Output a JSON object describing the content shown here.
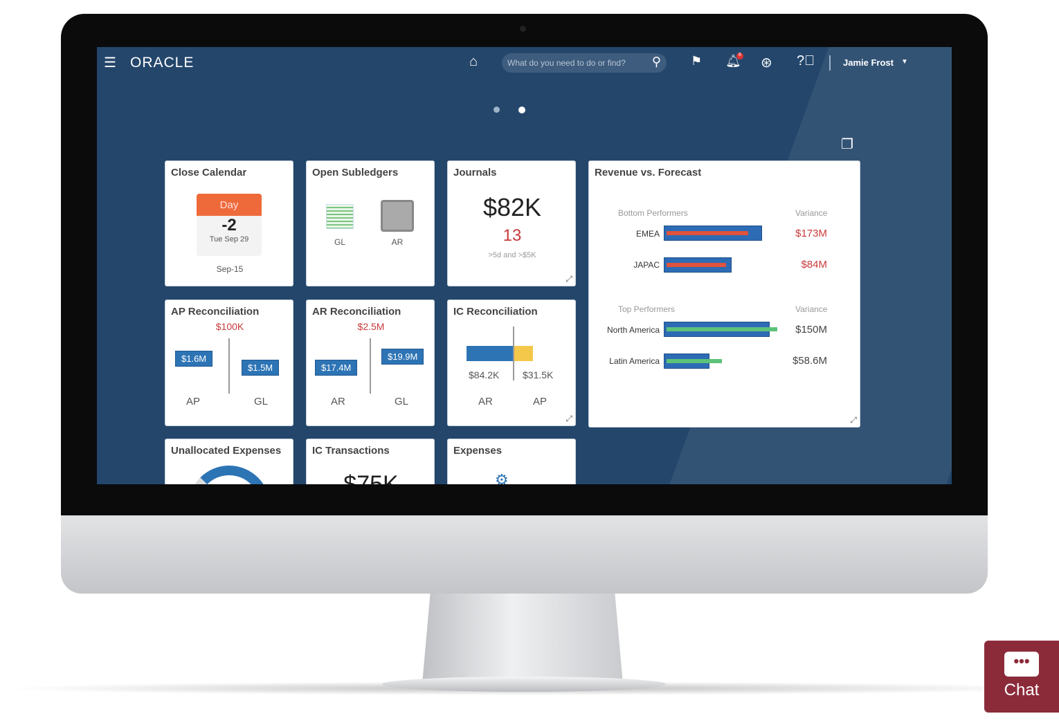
{
  "header": {
    "logo": "ORACLE",
    "search_placeholder": "What do you need to do or find?",
    "user": "Jamie Frost",
    "notification_count": "6"
  },
  "tiles": {
    "close_calendar": {
      "title": "Close Calendar",
      "badge": "Day",
      "day": "-2",
      "date": "Tue Sep 29",
      "period": "Sep-15"
    },
    "open_subledgers": {
      "title": "Open Subledgers",
      "items": [
        "GL",
        "AR"
      ]
    },
    "journals": {
      "title": "Journals",
      "amount": "$82K",
      "count": "13",
      "caption": ">5d and >$5K"
    },
    "ap_recon": {
      "title": "AP Reconciliation",
      "diff": "$100K",
      "left_value": "$1.6M",
      "right_value": "$1.5M",
      "left_label": "AP",
      "right_label": "GL"
    },
    "ar_recon": {
      "title": "AR Reconciliation",
      "diff": "$2.5M",
      "left_value": "$17.4M",
      "right_value": "$19.9M",
      "left_label": "AR",
      "right_label": "GL"
    },
    "ic_recon": {
      "title": "IC Reconciliation",
      "left_value": "$84.2K",
      "right_value": "$31.5K",
      "left_label": "AR",
      "right_label": "AP"
    },
    "unallocated": {
      "title": "Unallocated Expenses"
    },
    "ic_transactions": {
      "title": "IC Transactions",
      "amount": "$75K"
    },
    "expenses": {
      "title": "Expenses"
    }
  },
  "revenue": {
    "title": "Revenue vs. Forecast",
    "bottom": {
      "heading": "Bottom Performers",
      "variance_label": "Variance",
      "rows": [
        {
          "name": "EMEA",
          "variance": "$173M"
        },
        {
          "name": "JAPAC",
          "variance": "$84M"
        }
      ]
    },
    "top": {
      "heading": "Top Performers",
      "variance_label": "Variance",
      "rows": [
        {
          "name": "North America",
          "variance": "$150M"
        },
        {
          "name": "Latin America",
          "variance": "$58.6M"
        }
      ]
    }
  },
  "colors": {
    "screen": "#24466b",
    "bar": "#2d6bb5",
    "negative": "#e0533d",
    "positive": "#5cc27a",
    "chat": "#8b2b3a"
  },
  "chat": {
    "label": "Chat"
  }
}
